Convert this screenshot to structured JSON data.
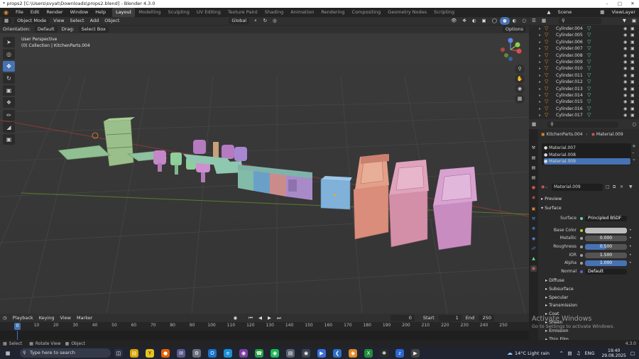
{
  "window": {
    "title": "* props2 [C:\\Users\\svyat\\Downloads\\props2.blend] - Blender 4.3.0"
  },
  "menu": [
    "File",
    "Edit",
    "Render",
    "Window",
    "Help"
  ],
  "workspaces": [
    "Layout",
    "Modelling",
    "Sculpting",
    "UV Editing",
    "Texture Paint",
    "Shading",
    "Animation",
    "Rendering",
    "Compositing",
    "Geometry Nodes",
    "Scripting"
  ],
  "active_workspace": "Layout",
  "scene": "Scene",
  "view_layer": "ViewLayer",
  "header": {
    "mode": "Object Mode",
    "view": "View",
    "select": "Select",
    "add": "Add",
    "object": "Object",
    "transform_orientation": "Global",
    "options": "Options"
  },
  "header2": {
    "orientation_label": "Orientation:",
    "orientation": "Default",
    "drag_label": "Drag:",
    "drag": "Select Box"
  },
  "viewport": {
    "perspective": "User Perspective",
    "collection": "(0) Collection | KitchenParts.004"
  },
  "outliner": {
    "items": [
      "Cylinder.004",
      "Cylinder.005",
      "Cylinder.006",
      "Cylinder.007",
      "Cylinder.008",
      "Cylinder.009",
      "Cylinder.010",
      "Cylinder.011",
      "Cylinder.012",
      "Cylinder.013",
      "Cylinder.014",
      "Cylinder.015",
      "Cylinder.016",
      "Cylinder.017"
    ]
  },
  "properties": {
    "object": "KitchenParts.004",
    "material": "Material.009",
    "slots": [
      "Material.007",
      "Material.008",
      "Material.009"
    ],
    "active_slot": 2,
    "panel_preview": "Preview",
    "panel_surface": "Surface",
    "surface_label": "Surface",
    "surface_value": "Principled BSDF",
    "base_color_label": "Base Color",
    "base_color": "#bdbdbd",
    "metallic_label": "Metallic",
    "metallic": "0.000",
    "roughness_label": "Roughness",
    "roughness": "0.500",
    "roughness_fraction": 0.5,
    "ior_label": "IOR",
    "ior": "1.500",
    "alpha_label": "Alpha",
    "alpha": "1.000",
    "alpha_fraction": 1.0,
    "normal_label": "Normal",
    "normal": "Default",
    "subpanels": [
      "Diffuse",
      "Subsurface",
      "Specular",
      "Transmission",
      "Coat",
      "Sheen",
      "Emission",
      "Thin Film"
    ]
  },
  "timeline": {
    "playback": "Playback",
    "keying": "Keying",
    "view": "View",
    "marker": "Marker",
    "current_frame": "0",
    "start_label": "Start",
    "start": "1",
    "end_label": "End",
    "end": "250",
    "ticks": [
      "0",
      "10",
      "20",
      "30",
      "40",
      "50",
      "60",
      "70",
      "80",
      "90",
      "100",
      "110",
      "120",
      "130",
      "140",
      "150",
      "160",
      "170",
      "180",
      "190",
      "200",
      "210",
      "220",
      "230",
      "240",
      "250"
    ]
  },
  "statusbar": {
    "select": "Select",
    "rotate": "Rotate View",
    "object": "Object",
    "version": "4.3.0"
  },
  "watermark": {
    "title": "Activate Windows",
    "subtitle": "Go to Settings to activate Windows."
  },
  "taskbar": {
    "search": "Type here to search",
    "weather": "14°C  Light rain",
    "lang": "ENG",
    "time": "19:40",
    "date": "29.08.2025"
  },
  "colors": {
    "accent": "#4772b3",
    "object_orange": "#e0892a",
    "mesh_green": "#6cd49c"
  }
}
